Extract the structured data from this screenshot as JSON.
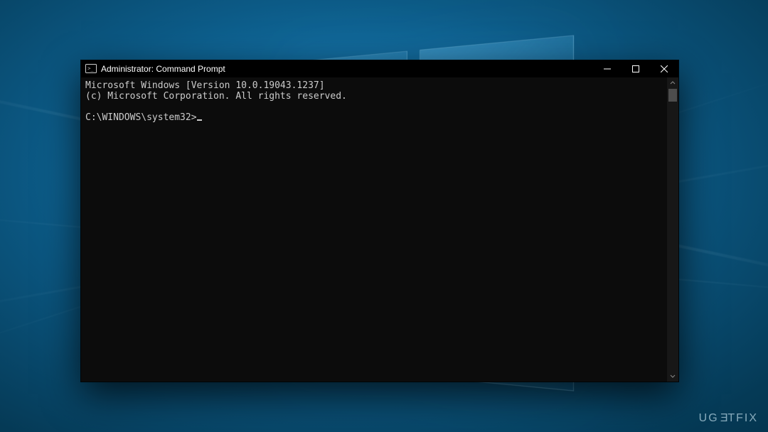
{
  "window": {
    "title": "Administrator: Command Prompt"
  },
  "console": {
    "line1": "Microsoft Windows [Version 10.0.19043.1237]",
    "line2": "(c) Microsoft Corporation. All rights reserved.",
    "blank": "",
    "prompt": "C:\\WINDOWS\\system32>"
  },
  "watermark": {
    "pre": "UG",
    "mid": "E",
    "post": "TFIX"
  }
}
